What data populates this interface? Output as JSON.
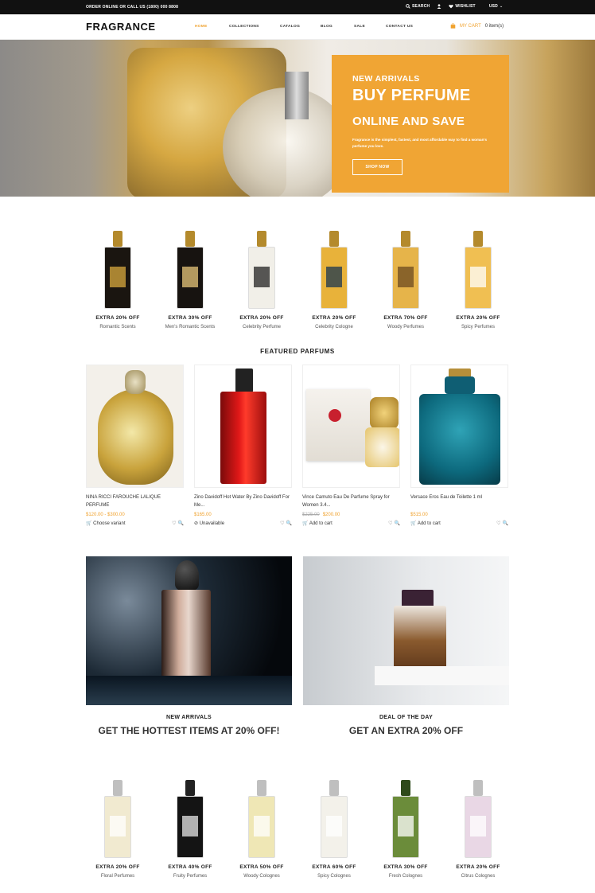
{
  "topbar": {
    "order_text": "ORDER ONLINE OR CALL US (1800) 000 8808",
    "search": "SEARCH",
    "wishlist": "WISHLIST",
    "currency": "USD"
  },
  "header": {
    "logo": "FRAGRANCE",
    "nav": [
      "HOME",
      "COLLECTIONS",
      "CATALOG",
      "BLOG",
      "SALE",
      "CONTACT US"
    ],
    "cart_label": "MY CART",
    "cart_count": "0 item(s)"
  },
  "hero": {
    "kicker": "NEW ARRIVALS",
    "title": "BUY PERFUME",
    "subtitle": "ONLINE AND SAVE",
    "description": "Fragrance is the simplest, fastest, and most affordable way to find a woman's perfume you love.",
    "button": "SHOP NOW"
  },
  "promos_top": [
    {
      "offer": "EXTRA 20% OFF",
      "label": "Romantic Scents",
      "cap": "#b48a2c",
      "body": "#1a1510",
      "accent": "#d9a93e"
    },
    {
      "offer": "EXTRA 30% OFF",
      "label": "Men's Romantic Scents",
      "cap": "#b48a2c",
      "body": "#171310",
      "accent": "#e8c77a"
    },
    {
      "offer": "EXTRA 20% OFF",
      "label": "Celebrity Perfume",
      "cap": "#b48a2c",
      "body": "#f1efe8",
      "accent": "#222"
    },
    {
      "offer": "EXTRA 20% OFF",
      "label": "Celebrity Cologne",
      "cap": "#b48a2c",
      "body": "#e8b23a",
      "accent": "#1b3550"
    },
    {
      "offer": "EXTRA 70% OFF",
      "label": "Woody Perfumes",
      "cap": "#b48a2c",
      "body": "#e6b44a",
      "accent": "#6b4a20"
    },
    {
      "offer": "EXTRA 20% OFF",
      "label": "Spicy Perfumes",
      "cap": "#b48a2c",
      "body": "#f0bf52",
      "accent": "#fff"
    }
  ],
  "featured_title": "FEATURED PARFUMS",
  "products": [
    {
      "title": "NINA RICCI FAROUCHE LALIQUE PERFUME",
      "old_price": "",
      "price": "$120.00 - $300.00",
      "action": "Choose variant",
      "action_icon": "cart-icon"
    },
    {
      "title": "Zino Davidoff Hot Water By Zino Davidoff For Me...",
      "old_price": "",
      "price": "$165.00",
      "action": "Unavailable",
      "action_icon": "unavailable-icon"
    },
    {
      "title": "Vince Camuto Eau De Parfume Spray for Women 3.4...",
      "old_price": "$225.00",
      "price": "$200.00",
      "action": "Add to cart",
      "action_icon": "cart-icon"
    },
    {
      "title": "Versace Eros Eau de Toilette 1 ml",
      "old_price": "",
      "price": "$515.00",
      "action": "Add to cart",
      "action_icon": "cart-icon"
    }
  ],
  "banners": [
    {
      "kicker": "NEW ARRIVALS",
      "headline": "GET THE HOTTEST ITEMS AT 20% OFF!"
    },
    {
      "kicker": "DEAL OF THE DAY",
      "headline": "GET AN EXTRA 20% OFF"
    }
  ],
  "promos_bottom": [
    {
      "offer": "EXTRA 20% OFF",
      "label": "Floral Perfumes",
      "cap": "#bfbfbf",
      "body": "#f1ead0",
      "accent": "#fff"
    },
    {
      "offer": "EXTRA 40% OFF",
      "label": "Fruity Perfumes",
      "cap": "#222",
      "body": "#141414",
      "accent": "#e6e6e6"
    },
    {
      "offer": "EXTRA 50% OFF",
      "label": "Woody Colognes",
      "cap": "#bfbfbf",
      "body": "#efe7b5",
      "accent": "#fff"
    },
    {
      "offer": "EXTRA 60% OFF",
      "label": "Spicy Colognes",
      "cap": "#bfbfbf",
      "body": "#f3f1ea",
      "accent": "#fff"
    },
    {
      "offer": "EXTRA 30% OFF",
      "label": "Fresh Colognes",
      "cap": "#2e4a1a",
      "body": "#6b8c3a",
      "accent": "#fff"
    },
    {
      "offer": "EXTRA 20% OFF",
      "label": "Citrus Colognes",
      "cap": "#bfbfbf",
      "body": "#e9d7e5",
      "accent": "#fff"
    }
  ],
  "colors": {
    "accent": "#f0a534",
    "price": "#f0a22e",
    "topbar": "#111111"
  }
}
